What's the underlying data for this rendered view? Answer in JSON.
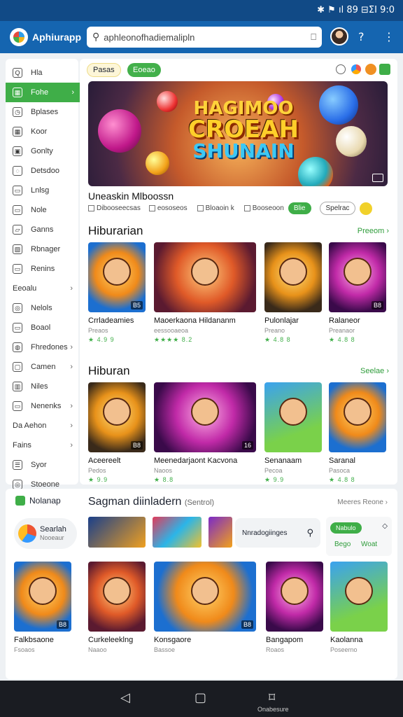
{
  "status": {
    "right": "✱ ⚑ ıl 89 ⊟ΣΙ 9:0"
  },
  "appbar": {
    "title": "Aphiurapp",
    "search_value": "aphleonofhadiemalipln"
  },
  "sidebar": {
    "items": [
      {
        "icon": "Q",
        "label": "Hla",
        "chev": ""
      },
      {
        "icon": "▦",
        "label": "Fohe",
        "chev": "›",
        "active": true
      },
      {
        "icon": "◷",
        "label": "Bplases",
        "chev": ""
      },
      {
        "icon": "▦",
        "label": "Koor",
        "chev": ""
      },
      {
        "icon": "▣",
        "label": "Gonlty",
        "chev": ""
      },
      {
        "icon": "◌",
        "label": "Detsdoo",
        "chev": ""
      },
      {
        "icon": "▭",
        "label": "Lnlsg",
        "chev": ""
      },
      {
        "icon": "▭",
        "label": "Nole",
        "chev": ""
      },
      {
        "icon": "▱",
        "label": "Ganns",
        "chev": ""
      },
      {
        "icon": "▧",
        "label": "Rbnager",
        "chev": ""
      },
      {
        "icon": "▭",
        "label": "Renins",
        "chev": ""
      },
      {
        "icon": "",
        "label": "Eeoalu",
        "chev": "›"
      },
      {
        "icon": "◎",
        "label": "Nelols",
        "chev": ""
      },
      {
        "icon": "▭",
        "label": "Boaol",
        "chev": ""
      },
      {
        "icon": "◍",
        "label": "Fhredones",
        "chev": "›"
      },
      {
        "icon": "▢",
        "label": "Camen",
        "chev": "›"
      },
      {
        "icon": "▥",
        "label": "Niles",
        "chev": ""
      },
      {
        "icon": "▭",
        "label": "Nenenks",
        "chev": "›"
      },
      {
        "icon": "",
        "label": "Da Aehon",
        "chev": "›"
      },
      {
        "icon": "",
        "label": "Fains",
        "chev": "›"
      },
      {
        "icon": "☰",
        "label": "Syor",
        "chev": ""
      },
      {
        "icon": "◎",
        "label": "Stoeone",
        "chev": ""
      }
    ]
  },
  "chips": {
    "a": "Pasas",
    "b": "Eoeao"
  },
  "hero": {
    "line1": "HAGIMOO",
    "line2": "CROEAH",
    "line3": "SHUNAIN"
  },
  "featured": {
    "name": "Uneaskin Mlboossn",
    "opt1": "Dibooseecsas",
    "opt2": "eososeos",
    "opt3": "Bloaoin k",
    "opt4": "Booseoon",
    "btn": "Blie",
    "btn2": "Spelrac"
  },
  "section1": {
    "title": "Hiburarian",
    "link": "Preeom ›",
    "cards": [
      {
        "name": "Crrladeamies",
        "meta": "Preaos",
        "rating": "★ 4.9 9",
        "tag": "B5"
      },
      {
        "name": "Maoerkaona  Hildananm",
        "meta": "eessooaeoa",
        "rating": "★★★★ 8.2",
        "tag": ""
      },
      {
        "name": "Pulonlajar",
        "meta": "Preano",
        "rating": "★ 4.8 8",
        "tag": ""
      },
      {
        "name": "Ralaneor",
        "meta": "Preanaor",
        "rating": "★ 4.8 8",
        "tag": "B8"
      }
    ]
  },
  "section2": {
    "title": "Hiburan",
    "link": "Seelae ›",
    "cards": [
      {
        "name": "Aceereelt",
        "meta": "Pedos",
        "rating": "★ 9.9",
        "tag": "B8"
      },
      {
        "name": "Meenedarjaont  Kacvona",
        "meta": "Naoos",
        "rating": "★ 8.8",
        "tag": "16"
      },
      {
        "name": "Senanaam",
        "meta": "Pecoa",
        "rating": "★ 9.9",
        "tag": ""
      },
      {
        "name": "Saranal",
        "meta": "Pasoca",
        "rating": "★ 4.8 8",
        "tag": ""
      }
    ]
  },
  "section3": {
    "brand": "Nolanap",
    "title": "Sagman diinladern",
    "title_sub": "(Sentrol)",
    "link": "Meeres Reone ›",
    "promo": "Searlah",
    "promo_sub": "Nooeaur",
    "search_text": "Nnradogiinges",
    "side_btn": "Nabulo",
    "side_l1": "Bego",
    "side_l2": "Woat",
    "cards": [
      {
        "name": "Falkbsaone",
        "meta": "Fsoaos",
        "tag": "B8"
      },
      {
        "name": "Curkeleeklng",
        "meta": "Naaoo",
        "tag": ""
      },
      {
        "name": "Konsgaore",
        "meta": "Bassoe",
        "tag": "B8"
      },
      {
        "name": "Bangapom",
        "meta": "Roaos",
        "tag": ""
      },
      {
        "name": "Kaolanna",
        "meta": "Poseerno",
        "tag": ""
      }
    ]
  },
  "navbar": {
    "label": "Onabesure"
  },
  "colors": {
    "primary": "#1565b0",
    "accent": "#3fae48"
  }
}
